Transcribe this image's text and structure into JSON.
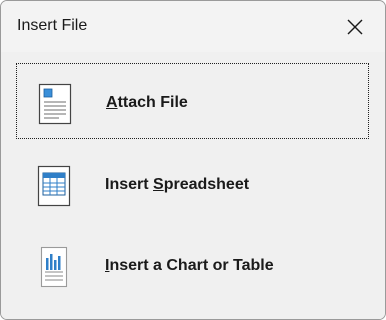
{
  "dialog": {
    "title": "Insert File",
    "close_icon": "close-icon"
  },
  "options": [
    {
      "label_mnemonic": "A",
      "label_rest": "ttach File",
      "icon": "document-icon"
    },
    {
      "label_prefix": "Insert ",
      "label_mnemonic": "S",
      "label_rest": "preadsheet",
      "icon": "spreadsheet-icon"
    },
    {
      "label_mnemonic": "I",
      "label_rest": "nsert a Chart or Table",
      "icon": "chart-document-icon"
    }
  ]
}
